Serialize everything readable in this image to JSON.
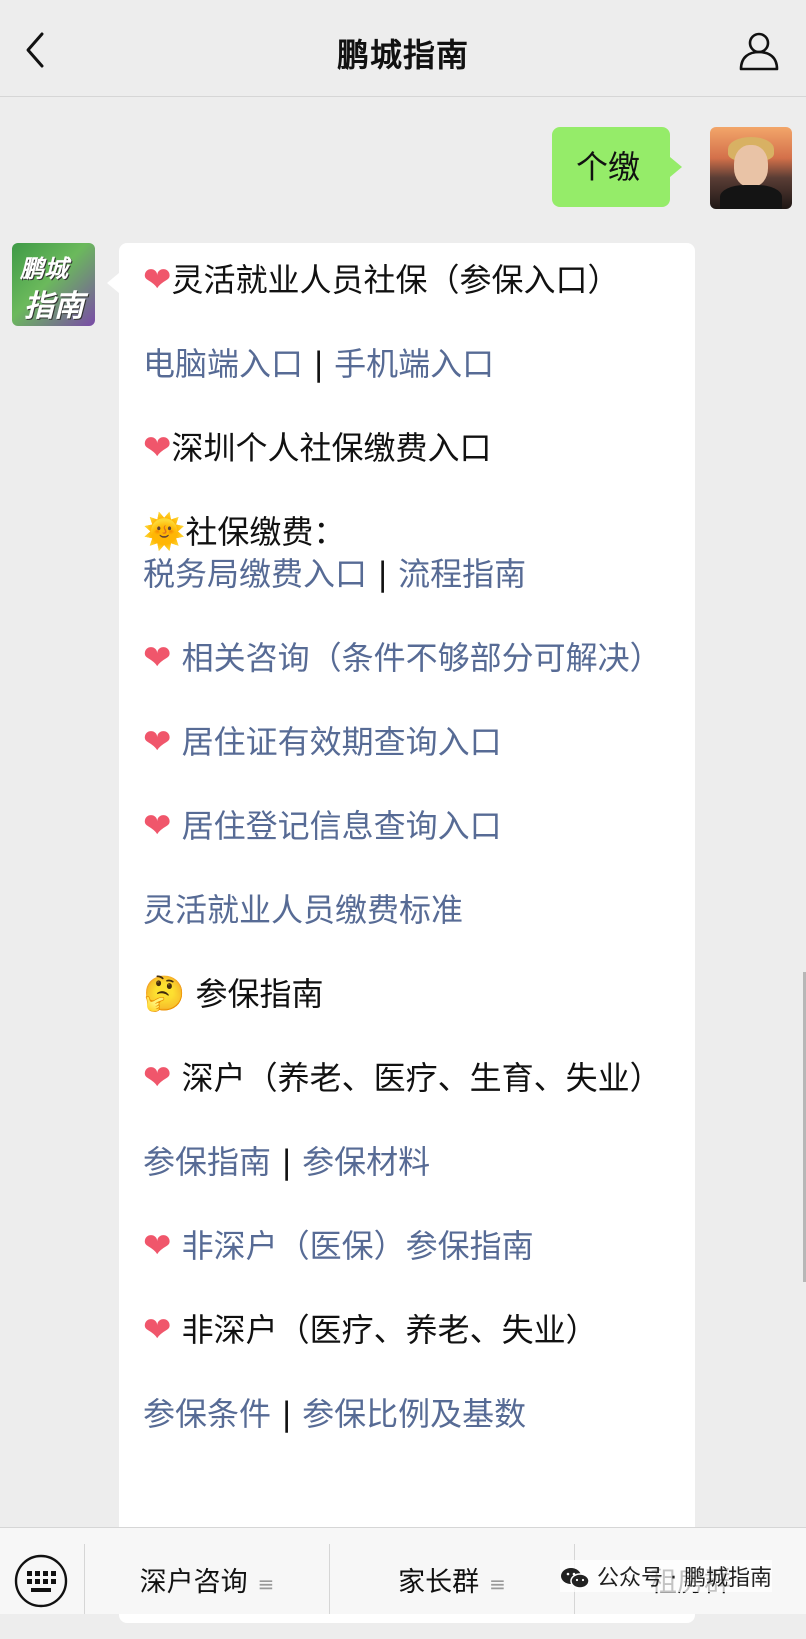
{
  "header": {
    "title": "鹏城指南",
    "back_icon": "chevron-left-icon",
    "profile_icon": "person-icon"
  },
  "outgoing": {
    "text": "个缴"
  },
  "bot": {
    "avatar_line1": "鹏城",
    "avatar_line2": "指南",
    "message": {
      "p1": "灵活就业人员社保（参保入口）",
      "p2_link1": "电脑端入口",
      "p2_sep": " | ",
      "p2_link2": "手机端入口",
      "p3": "深圳个人社保缴费入口",
      "p4_title": "社保缴费：",
      "p4_link1": "税务局缴费入口",
      "p4_sep": " | ",
      "p4_link2": "流程指南",
      "p5": " 相关咨询（条件不够部分可解决）",
      "p6": " 居住证有效期查询入口",
      "p7": " 居住登记信息查询入口",
      "p8": "灵活就业人员缴费标准",
      "p9": " 参保指南",
      "p10": " 深户（养老、医疗、生育、失业）",
      "p11_link1": "参保指南",
      "p11_sep": " | ",
      "p11_link2": "参保材料",
      "p12": " 非深户（医保）参保指南",
      "p13": " 非深户（医疗、养老、失业）",
      "p14_link1": "参保条件",
      "p14_sep": " | ",
      "p14_link2": "参保比例及基数"
    },
    "emoji": {
      "heart": "❤",
      "sun": "🌞",
      "thinking": "🤔"
    }
  },
  "menu": {
    "keyboard_icon": "keyboard-icon",
    "item1": "深户咨询",
    "item2": "家长群",
    "item3": "租房群",
    "submenu_mark": "≡"
  },
  "watermark": {
    "wechat_icon": "wechat-icon",
    "text": "公众号 · 鹏城指南"
  },
  "colors": {
    "background": "#ededed",
    "outgoing_bubble": "#95ec69",
    "link": "#576b95",
    "heart": "#f0566b"
  }
}
